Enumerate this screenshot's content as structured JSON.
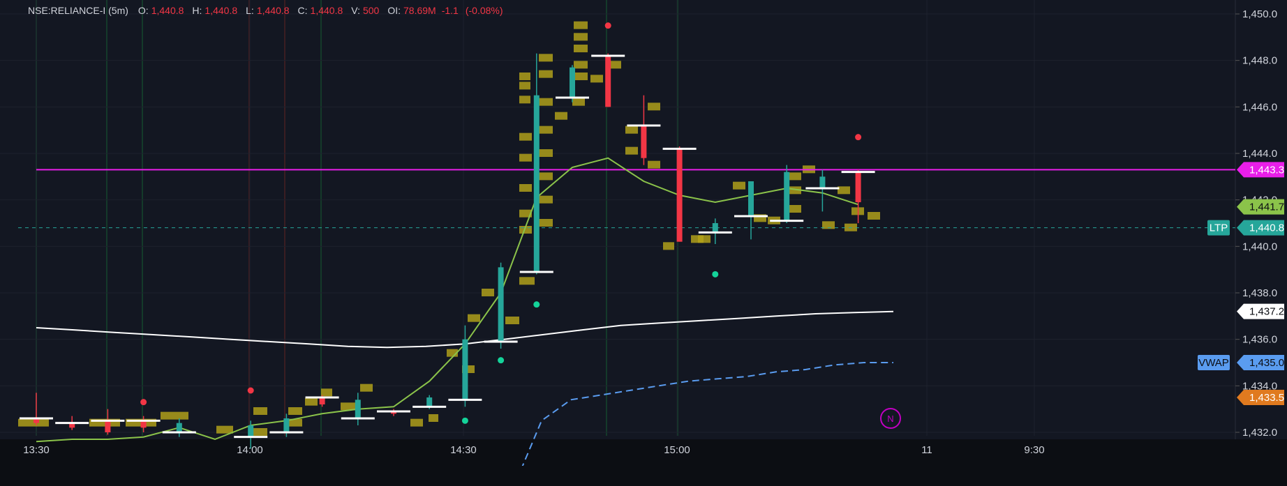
{
  "header": {
    "symbol": "NSE:RELIANCE-I (5m)",
    "o_label": "O:",
    "o_value": "1,440.8",
    "h_label": "H:",
    "h_value": "1,440.8",
    "l_label": "L:",
    "l_value": "1,440.8",
    "c_label": "C:",
    "c_value": "1,440.8",
    "v_label": "V:",
    "v_value": "500",
    "oi_label": "OI:",
    "oi_value": "78.69M",
    "change": "-1.1",
    "change_pct": "(-0.08%)"
  },
  "colors": {
    "background": "#131722",
    "up": "#26a69a",
    "down": "#f23645",
    "volume_profile": "#b5a31a",
    "ema": "#8bc34a",
    "vwap": "#5a9cf0",
    "ma_white": "#ffffff",
    "resistance": "#e91ee9",
    "ltp": "#26a69a",
    "badge_orange": "#e07a1f"
  },
  "chart_data": {
    "type": "line",
    "title": "",
    "xlabel": "",
    "ylabel": "",
    "ylim": [
      1431.8,
      1450.6
    ],
    "y_ticks": [
      "1,450.0",
      "1,448.0",
      "1,446.0",
      "1,444.0",
      "1,442.0",
      "1,440.0",
      "1,438.0",
      "1,436.0",
      "1,434.0",
      "1,432.0"
    ],
    "x_ticks": [
      "13:30",
      "14:00",
      "14:30",
      "15:00",
      "11",
      "9:30"
    ],
    "candles": [
      {
        "t": "13:30",
        "o": 1432.6,
        "h": 1433.7,
        "l": 1432.3,
        "c": 1432.4
      },
      {
        "t": "13:35",
        "o": 1432.4,
        "h": 1432.7,
        "l": 1432.1,
        "c": 1432.2
      },
      {
        "t": "13:40",
        "o": 1432.5,
        "h": 1433.0,
        "l": 1431.9,
        "c": 1432.0
      },
      {
        "t": "13:45",
        "o": 1432.5,
        "h": 1432.7,
        "l": 1432.0,
        "c": 1432.2
      },
      {
        "t": "13:50",
        "o": 1432.0,
        "h": 1432.6,
        "l": 1431.8,
        "c": 1432.4
      },
      {
        "t": "14:00",
        "o": 1431.8,
        "h": 1432.5,
        "l": 1431.3,
        "c": 1432.3
      },
      {
        "t": "14:05",
        "o": 1432.0,
        "h": 1432.8,
        "l": 1431.8,
        "c": 1432.6
      },
      {
        "t": "14:10",
        "o": 1433.5,
        "h": 1433.6,
        "l": 1433.1,
        "c": 1433.2
      },
      {
        "t": "14:15",
        "o": 1432.6,
        "h": 1433.7,
        "l": 1432.3,
        "c": 1433.4
      },
      {
        "t": "14:20",
        "o": 1432.9,
        "h": 1433.0,
        "l": 1432.7,
        "c": 1432.8
      },
      {
        "t": "14:25",
        "o": 1433.1,
        "h": 1433.6,
        "l": 1433.0,
        "c": 1433.5
      },
      {
        "t": "14:30",
        "o": 1433.4,
        "h": 1436.6,
        "l": 1433.1,
        "c": 1436.0
      },
      {
        "t": "14:35",
        "o": 1435.9,
        "h": 1439.3,
        "l": 1435.6,
        "c": 1439.1
      },
      {
        "t": "14:40",
        "o": 1438.9,
        "h": 1448.3,
        "l": 1438.8,
        "c": 1446.5
      },
      {
        "t": "14:45",
        "o": 1446.4,
        "h": 1447.8,
        "l": 1446.2,
        "c": 1447.7
      },
      {
        "t": "14:50",
        "o": 1448.2,
        "h": 1448.3,
        "l": 1446.0,
        "c": 1446.0
      },
      {
        "t": "14:55",
        "o": 1445.2,
        "h": 1446.5,
        "l": 1443.5,
        "c": 1443.8
      },
      {
        "t": "15:00",
        "o": 1444.2,
        "h": 1444.3,
        "l": 1440.2,
        "c": 1440.2
      },
      {
        "t": "15:05",
        "o": 1440.6,
        "h": 1441.2,
        "l": 1440.1,
        "c": 1441.0
      },
      {
        "t": "15:10",
        "o": 1441.3,
        "h": 1442.8,
        "l": 1440.3,
        "c": 1442.8
      },
      {
        "t": "15:15",
        "o": 1441.1,
        "h": 1443.5,
        "l": 1441.0,
        "c": 1443.2
      },
      {
        "t": "15:20",
        "o": 1442.5,
        "h": 1443.3,
        "l": 1441.5,
        "c": 1443.0
      },
      {
        "t": "15:25",
        "o": 1443.2,
        "h": 1443.3,
        "l": 1441.0,
        "c": 1441.9
      }
    ],
    "series": [
      {
        "values": [
          1431.6,
          1431.7,
          1431.7,
          1431.8,
          1432.2,
          1431.7,
          1432.3,
          1432.5,
          1432.8,
          1433.0,
          1433.1,
          1434.2,
          1435.8,
          1438.0,
          1442.1,
          1443.4,
          1443.8,
          1442.8,
          1442.2,
          1441.9,
          1442.2,
          1442.5,
          1442.3,
          1441.8
        ]
      },
      {
        "values": [
          1436.5,
          1436.4,
          1436.3,
          1436.2,
          1436.1,
          1436.0,
          1435.9,
          1435.8,
          1435.7,
          1435.65,
          1435.7,
          1435.8,
          1436.0,
          1436.2,
          1436.4,
          1436.6,
          1436.7,
          1436.8,
          1436.9,
          1437.0,
          1437.1,
          1437.15,
          1437.2
        ]
      },
      {
        "values": [
          1429.5,
          1432.5,
          1433.4,
          1433.6,
          1433.8,
          1434.0,
          1434.2,
          1434.3,
          1434.4,
          1434.6,
          1434.7,
          1434.9,
          1435.0,
          1435.0
        ]
      }
    ],
    "levels": {
      "resistance": 1443.3,
      "ltp": 1440.8,
      "badge_green": 1441.7,
      "badge_white": 1437.2,
      "vwap": 1435.0,
      "badge_orange": 1433.5
    },
    "badges": {
      "resistance": "1,443.3",
      "ema": "1,441.7",
      "ltp_tag": "LTP",
      "ltp": "1,440.8",
      "white": "1,437.2",
      "vwap_tag": "VWAP",
      "vwap": "1,435.0",
      "orange": "1,433.5"
    },
    "dots": [
      {
        "t": "13:45",
        "p": 1433.3,
        "color": "#f23645"
      },
      {
        "t": "14:00",
        "p": 1433.8,
        "color": "#f23645"
      },
      {
        "t": "14:30",
        "p": 1432.5,
        "color": "#14d39a"
      },
      {
        "t": "14:35",
        "p": 1435.1,
        "color": "#14d39a"
      },
      {
        "t": "14:40",
        "p": 1437.5,
        "color": "#14d39a"
      },
      {
        "t": "14:50",
        "p": 1449.5,
        "color": "#f23645"
      },
      {
        "t": "15:05",
        "p": 1438.8,
        "color": "#14d39a"
      },
      {
        "t": "15:25",
        "p": 1444.7,
        "color": "#f23645"
      }
    ],
    "news_marker": "N"
  }
}
